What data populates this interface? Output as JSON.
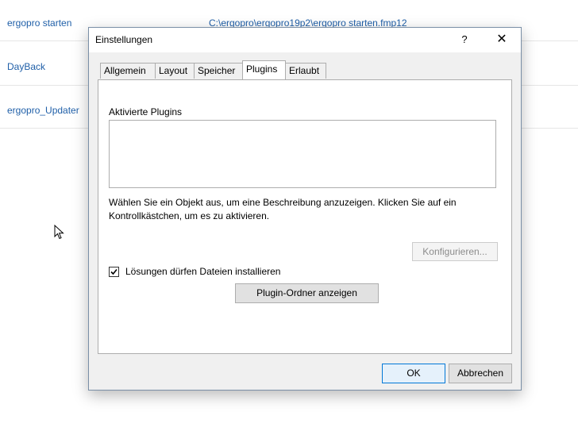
{
  "background": {
    "items": [
      {
        "label": "ergopro starten"
      },
      {
        "label": "DayBack"
      },
      {
        "label": "ergopro_Updater"
      }
    ],
    "path": "C:\\ergopro\\ergopro19p2\\ergopro starten.fmp12"
  },
  "dialog": {
    "title": "Einstellungen",
    "help_label": "?",
    "close_label": "✕",
    "tabs": [
      {
        "label": "Allgemein"
      },
      {
        "label": "Layout"
      },
      {
        "label": "Speicher"
      },
      {
        "label": "Plugins"
      },
      {
        "label": "Erlaubt"
      }
    ],
    "active_tab": "Plugins",
    "plugins": {
      "section_label": "Aktivierte Plugins",
      "items": [],
      "description": "Wählen Sie ein Objekt aus, um eine Beschreibung anzuzeigen. Klicken Sie auf ein Kontrollkästchen, um es zu aktivieren.",
      "configure_label": "Konfigurieren...",
      "configure_enabled": false,
      "allow_install_label": "Lösungen dürfen Dateien installieren",
      "allow_install_checked": true,
      "show_folder_label": "Plugin-Ordner anzeigen"
    },
    "ok_label": "OK",
    "cancel_label": "Abbrechen"
  }
}
